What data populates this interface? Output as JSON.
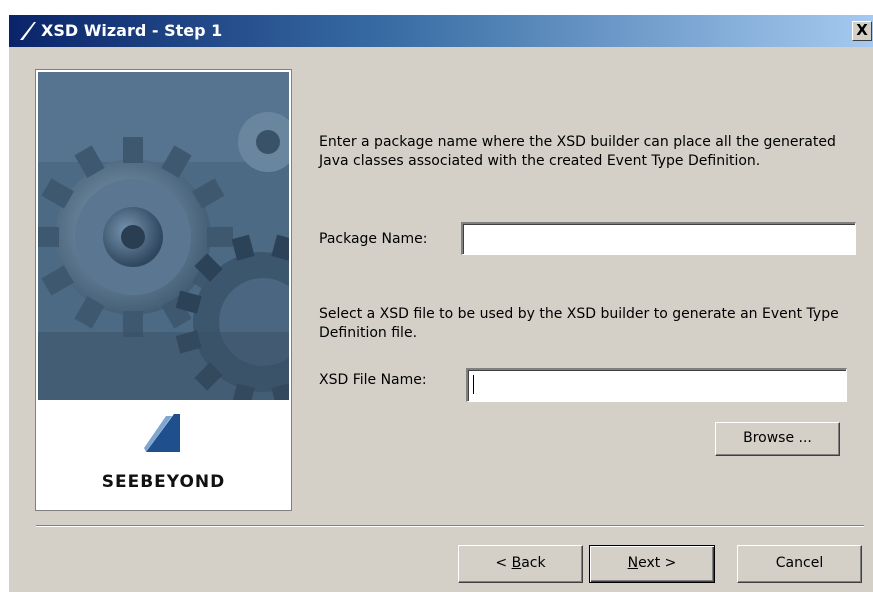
{
  "window": {
    "title": "XSD Wizard - Step 1",
    "close_label": "X",
    "title_icon": "seebeyond-logo-icon",
    "colors": {
      "titlebar_start": "#0a246a",
      "titlebar_end": "#a6caf0",
      "face": "#d4d0c8"
    }
  },
  "side_panel": {
    "image": "gears-illustration",
    "logo_icon": "seebeyond-logo-icon",
    "brand": "SEEBEYOND"
  },
  "package_section": {
    "instructions": "Enter a package name where the XSD builder can place all the generated Java classes associated with the created Event Type Definition.",
    "label": "Package Name:",
    "value": ""
  },
  "xsd_section": {
    "instructions": "Select a XSD file to be used by the XSD builder to generate an Event Type Definition file.",
    "label": "XSD File Name:",
    "value": ""
  },
  "buttons": {
    "browse": "Browse ...",
    "back_prefix": "< ",
    "back_mnemonic": "B",
    "back_rest": "ack",
    "next_mnemonic": "N",
    "next_rest": "ext >",
    "cancel": "Cancel"
  }
}
